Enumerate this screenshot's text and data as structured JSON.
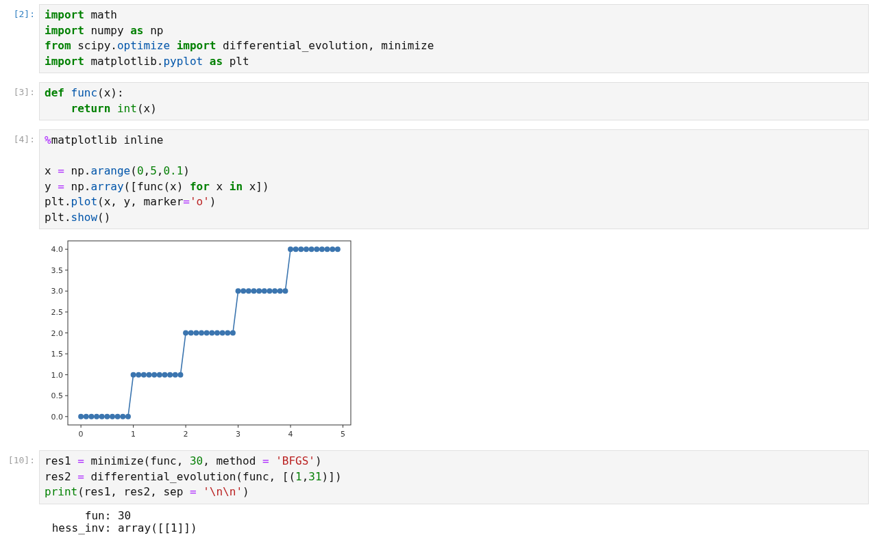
{
  "cells": [
    {
      "prompt": "[2]:",
      "active": true,
      "lines": [
        {
          "kind": "code",
          "tokens": [
            {
              "kind": "kw",
              "text": "import"
            },
            {
              "kind": "plain",
              "text": " math"
            }
          ]
        },
        {
          "kind": "code",
          "tokens": [
            {
              "kind": "kw",
              "text": "import"
            },
            {
              "kind": "plain",
              "text": " numpy "
            },
            {
              "kind": "kw",
              "text": "as"
            },
            {
              "kind": "plain",
              "text": " np"
            }
          ]
        },
        {
          "kind": "code",
          "tokens": [
            {
              "kind": "kw",
              "text": "from"
            },
            {
              "kind": "plain",
              "text": " scipy."
            },
            {
              "kind": "fn",
              "text": "optimize"
            },
            {
              "kind": "kw",
              "text": " import"
            },
            {
              "kind": "plain",
              "text": " differential_evolution, minimize"
            }
          ]
        },
        {
          "kind": "code",
          "tokens": [
            {
              "kind": "kw",
              "text": "import"
            },
            {
              "kind": "plain",
              "text": " matplotlib."
            },
            {
              "kind": "fn",
              "text": "pyplot"
            },
            {
              "kind": "kw",
              "text": " as"
            },
            {
              "kind": "plain",
              "text": " plt"
            }
          ]
        }
      ]
    },
    {
      "prompt": "[3]:",
      "active": false,
      "lines": [
        {
          "kind": "code",
          "tokens": [
            {
              "kind": "kw",
              "text": "def "
            },
            {
              "kind": "fn",
              "text": "func"
            },
            {
              "kind": "plain",
              "text": "(x):"
            }
          ]
        },
        {
          "kind": "code",
          "tokens": [
            {
              "kind": "kw",
              "text": "    return "
            },
            {
              "kind": "builtin",
              "text": "int"
            },
            {
              "kind": "plain",
              "text": "(x)"
            }
          ]
        }
      ]
    },
    {
      "prompt": "[4]:",
      "active": false,
      "lines": [
        {
          "kind": "code",
          "tokens": [
            {
              "kind": "op",
              "text": "%"
            },
            {
              "kind": "plain",
              "text": "matplotlib inline"
            }
          ]
        },
        {
          "kind": "blank"
        },
        {
          "kind": "code",
          "tokens": [
            {
              "kind": "plain",
              "text": "x "
            },
            {
              "kind": "op",
              "text": "="
            },
            {
              "kind": "plain",
              "text": " np."
            },
            {
              "kind": "fn",
              "text": "arange"
            },
            {
              "kind": "plain",
              "text": "("
            },
            {
              "kind": "num",
              "text": "0"
            },
            {
              "kind": "plain",
              "text": ","
            },
            {
              "kind": "num",
              "text": "5"
            },
            {
              "kind": "plain",
              "text": ","
            },
            {
              "kind": "num",
              "text": "0.1"
            },
            {
              "kind": "plain",
              "text": ")"
            }
          ]
        },
        {
          "kind": "code",
          "tokens": [
            {
              "kind": "plain",
              "text": "y "
            },
            {
              "kind": "op",
              "text": "="
            },
            {
              "kind": "plain",
              "text": " np."
            },
            {
              "kind": "fn",
              "text": "array"
            },
            {
              "kind": "plain",
              "text": "([func(x) "
            },
            {
              "kind": "kw",
              "text": "for"
            },
            {
              "kind": "plain",
              "text": " x "
            },
            {
              "kind": "kw",
              "text": "in"
            },
            {
              "kind": "plain",
              "text": " x])"
            }
          ]
        },
        {
          "kind": "code",
          "tokens": [
            {
              "kind": "plain",
              "text": "plt."
            },
            {
              "kind": "fn",
              "text": "plot"
            },
            {
              "kind": "plain",
              "text": "(x, y, marker"
            },
            {
              "kind": "op",
              "text": "="
            },
            {
              "kind": "str",
              "text": "'o'"
            },
            {
              "kind": "plain",
              "text": ")"
            }
          ]
        },
        {
          "kind": "code",
          "tokens": [
            {
              "kind": "plain",
              "text": "plt."
            },
            {
              "kind": "fn",
              "text": "show"
            },
            {
              "kind": "plain",
              "text": "()"
            }
          ]
        }
      ],
      "output": {
        "kind": "chart",
        "chart_data": {
          "type": "line",
          "x": [
            0,
            0.1,
            0.2,
            0.3,
            0.4,
            0.5,
            0.6,
            0.7,
            0.8,
            0.9,
            1,
            1.1,
            1.2,
            1.3,
            1.4,
            1.5,
            1.6,
            1.7,
            1.8,
            1.9,
            2,
            2.1,
            2.2,
            2.3,
            2.4,
            2.5,
            2.6,
            2.7,
            2.8,
            2.9,
            3,
            3.1,
            3.2,
            3.3,
            3.4,
            3.5,
            3.6,
            3.7,
            3.8,
            3.9,
            4,
            4.1,
            4.2,
            4.3,
            4.4,
            4.5,
            4.6,
            4.7,
            4.8,
            4.9
          ],
          "series": [
            {
              "color": "#3b75af",
              "marker": "o",
              "values": [
                0,
                0,
                0,
                0,
                0,
                0,
                0,
                0,
                0,
                0,
                1,
                1,
                1,
                1,
                1,
                1,
                1,
                1,
                1,
                1,
                2,
                2,
                2,
                2,
                2,
                2,
                2,
                2,
                2,
                2,
                3,
                3,
                3,
                3,
                3,
                3,
                3,
                3,
                3,
                3,
                4,
                4,
                4,
                4,
                4,
                4,
                4,
                4,
                4,
                4
              ]
            }
          ],
          "xlim": [
            -0.25,
            5.15
          ],
          "ylim": [
            -0.2,
            4.2
          ],
          "xticks": [
            0,
            1,
            2,
            3,
            4,
            5
          ],
          "yticks": [
            {
              "value": 0,
              "label": "0.0"
            },
            {
              "value": 0.5,
              "label": "0.5"
            },
            {
              "value": 1,
              "label": "1.0"
            },
            {
              "value": 1.5,
              "label": "1.5"
            },
            {
              "value": 2,
              "label": "2.0"
            },
            {
              "value": 2.5,
              "label": "2.5"
            },
            {
              "value": 3,
              "label": "3.0"
            },
            {
              "value": 3.5,
              "label": "3.5"
            },
            {
              "value": 4,
              "label": "4.0"
            }
          ]
        }
      }
    },
    {
      "prompt": "[10]:",
      "active": false,
      "lines": [
        {
          "kind": "code",
          "tokens": [
            {
              "kind": "plain",
              "text": "res1 "
            },
            {
              "kind": "op",
              "text": "="
            },
            {
              "kind": "plain",
              "text": " minimize(func, "
            },
            {
              "kind": "num",
              "text": "30"
            },
            {
              "kind": "plain",
              "text": ", method "
            },
            {
              "kind": "op",
              "text": "="
            },
            {
              "kind": "str",
              "text": " 'BFGS'"
            },
            {
              "kind": "plain",
              "text": ")"
            }
          ]
        },
        {
          "kind": "code",
          "tokens": [
            {
              "kind": "plain",
              "text": "res2 "
            },
            {
              "kind": "op",
              "text": "="
            },
            {
              "kind": "plain",
              "text": " differential_evolution(func, [("
            },
            {
              "kind": "num",
              "text": "1"
            },
            {
              "kind": "plain",
              "text": ","
            },
            {
              "kind": "num",
              "text": "31"
            },
            {
              "kind": "plain",
              "text": ")])"
            }
          ]
        },
        {
          "kind": "code",
          "tokens": [
            {
              "kind": "builtin",
              "text": "print"
            },
            {
              "kind": "plain",
              "text": "(res1, res2, sep "
            },
            {
              "kind": "op",
              "text": "="
            },
            {
              "kind": "str",
              "text": " '\\n\\n'"
            },
            {
              "kind": "plain",
              "text": ")"
            }
          ]
        }
      ],
      "output": {
        "kind": "text",
        "lines": [
          "      fun: 30",
          " hess_inv: array([[1]])"
        ]
      }
    }
  ]
}
